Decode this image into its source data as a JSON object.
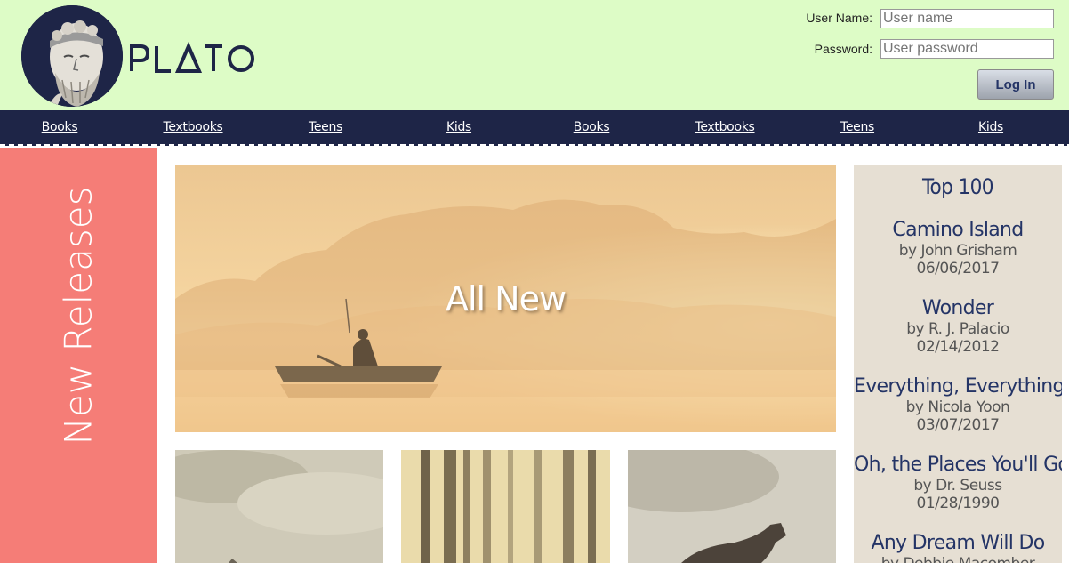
{
  "brand": {
    "name": "PLATO"
  },
  "login": {
    "username_label": "User Name:",
    "username_placeholder": "User name",
    "password_label": "Password:",
    "password_placeholder": "User password",
    "login_button": "Log In"
  },
  "nav": {
    "items": [
      "Books",
      "Textbooks",
      "Teens",
      "Kids",
      "Books",
      "Textbooks",
      "Teens",
      "Kids"
    ]
  },
  "sidebar": {
    "label": "New Releases"
  },
  "hero": {
    "title": "All New"
  },
  "top100": {
    "title": "Top 100",
    "books": [
      {
        "title": "Camino Island",
        "author": "by John Grisham",
        "date": "06/06/2017"
      },
      {
        "title": "Wonder",
        "author": "by R. J. Palacio",
        "date": "02/14/2012"
      },
      {
        "title": "Everything, Everything",
        "author": "by Nicola Yoon",
        "date": "03/07/2017"
      },
      {
        "title": "Oh, the Places You'll Go!",
        "author": "by Dr. Seuss",
        "date": "01/28/1990"
      },
      {
        "title": "Any Dream Will Do",
        "author": "by Debbie Macomber",
        "date": ""
      }
    ]
  },
  "colors": {
    "header_bg": "#ddfcc6",
    "nav_bg": "#1e2547",
    "sidebar_bg": "#f57d77",
    "top100_bg": "#e6dfd3",
    "accent_text": "#243466"
  }
}
